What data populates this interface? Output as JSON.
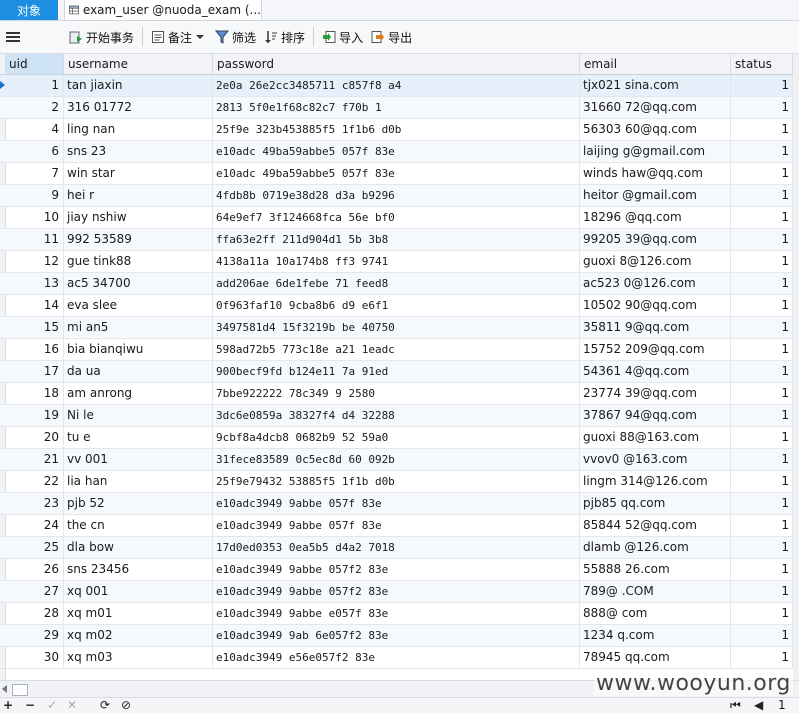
{
  "tabs": {
    "objects": "对象",
    "document": "exam_user @nuoda_exam (..."
  },
  "toolbar": {
    "begin_transaction": "开始事务",
    "memo": "备注",
    "filter": "筛选",
    "sort": "排序",
    "import": "导入",
    "export": "导出"
  },
  "columns": [
    "uid",
    "username",
    "password",
    "email",
    "status"
  ],
  "rows": [
    {
      "uid": "1",
      "username": "tan   jiaxin",
      "password": "2e0a    26e2cc3485711    c857f8    a4",
      "email": "tjx021     sina.com",
      "status": "1"
    },
    {
      "uid": "2",
      "username": "316    01772",
      "password": "2813     5f0e1f68c82c7     f70b    1",
      "email": "31660     72@qq.com",
      "status": "1"
    },
    {
      "uid": "4",
      "username": "ling    nan",
      "password": "25f9e     323b453885f5    1f1b6     d0b",
      "email": "56303     60@qq.com",
      "status": "1"
    },
    {
      "uid": "6",
      "username": "sns    23",
      "password": "e10adc     49ba59abbe5    057f     83e",
      "email": "laijing     g@gmail.com",
      "status": "1"
    },
    {
      "uid": "7",
      "username": "win    star",
      "password": "e10adc     49ba59abbe5    057f     83e",
      "email": "winds     haw@qq.com",
      "status": "1"
    },
    {
      "uid": "9",
      "username": "hei    r",
      "password": "4fdb8b     0719e38d28    d3a    b9296",
      "email": "heitor     @gmail.com",
      "status": "1"
    },
    {
      "uid": "10",
      "username": "jiay    nshiw",
      "password": "64e9ef7     3f124668fca    56e     bf0",
      "email": "18296     @qq.com",
      "status": "1"
    },
    {
      "uid": "11",
      "username": "992    53589",
      "password": "ffa63e2ff     211d904d1    5b    3b8",
      "email": "99205     39@qq.com",
      "status": "1"
    },
    {
      "uid": "12",
      "username": "gue    tink88",
      "password": "4138a11a     10a174b8    ff3     9741",
      "email": "guoxi     8@126.com",
      "status": "1"
    },
    {
      "uid": "13",
      "username": "ac5    34700",
      "password": "add206ae     6de1febe    71     feed8",
      "email": "ac523     0@126.com",
      "status": "1"
    },
    {
      "uid": "14",
      "username": "eva    slee",
      "password": "0f963faf10     9cba8b6     d9     e6f1",
      "email": "10502     90@qq.com",
      "status": "1"
    },
    {
      "uid": "15",
      "username": "mi    an5",
      "password": "3497581d4     15f3219b     be     40750",
      "email": "35811     9@qq.com",
      "status": "1"
    },
    {
      "uid": "16",
      "username": "bia    bianqiwu",
      "password": "598ad72b5     773c18e    a21     1eadc",
      "email": "15752     209@qq.com",
      "status": "1"
    },
    {
      "uid": "17",
      "username": "da    ua",
      "password": "900becf9fd     b124e11     7a     91ed",
      "email": "54361     4@qq.com",
      "status": "1"
    },
    {
      "uid": "18",
      "username": "am    anrong",
      "password": "7bbe922222     78c349     9     2580",
      "email": "23774     39@qq.com",
      "status": "1"
    },
    {
      "uid": "19",
      "username": "Ni    le",
      "password": "3dc6e0859a     38327f4     d4     32288",
      "email": "37867     94@qq.com",
      "status": "1"
    },
    {
      "uid": "20",
      "username": "tu    e",
      "password": "9cbf8a4dcb8     0682b9     52     59a0",
      "email": "guoxi     88@163.com",
      "status": "1"
    },
    {
      "uid": "21",
      "username": "vv    001",
      "password": "31fece83589     0c5ec8d     60     092b",
      "email": "vvov0     @163.com",
      "status": "1"
    },
    {
      "uid": "22",
      "username": "lia    han",
      "password": "25f9e79432     53885f5    1f1b     d0b",
      "email": "lingm     314@126.com",
      "status": "1"
    },
    {
      "uid": "23",
      "username": "pjb    52",
      "password": "e10adc3949     9abbe     057f     83e",
      "email": "pjb85     qq.com",
      "status": "1"
    },
    {
      "uid": "24",
      "username": "the    cn",
      "password": "e10adc3949     9abbe     057f     83e",
      "email": "85844     52@qq.com",
      "status": "1"
    },
    {
      "uid": "25",
      "username": "dla    bow",
      "password": "17d0ed0353     0ea5b5     d4a2     7018",
      "email": "dlamb     @126.com",
      "status": "1"
    },
    {
      "uid": "26",
      "username": "sns    23456",
      "password": "e10adc3949     9abbe     057f2     83e",
      "email": "55888     26.com",
      "status": "1"
    },
    {
      "uid": "27",
      "username": "xq    001",
      "password": "e10adc3949     9abbe     057f2     83e",
      "email": "789@     .COM",
      "status": "1"
    },
    {
      "uid": "28",
      "username": "xq    m01",
      "password": "e10adc3949     9abbe     e057f     83e",
      "email": "888@     com",
      "status": "1"
    },
    {
      "uid": "29",
      "username": "xq    m02",
      "password": "e10adc3949     9ab     6e057f2     83e",
      "email": "1234     q.com",
      "status": "1"
    },
    {
      "uid": "30",
      "username": "xq    m03",
      "password": "e10adc3949     e56e057f2     83e",
      "email": "78945     qq.com",
      "status": "1"
    }
  ],
  "statusbar": {
    "add": "+",
    "remove": "−",
    "apply": "✓",
    "discard": "✕",
    "refresh": "⟳",
    "stop": "⊘",
    "page": "1"
  },
  "watermark": "www.wooyun.org"
}
